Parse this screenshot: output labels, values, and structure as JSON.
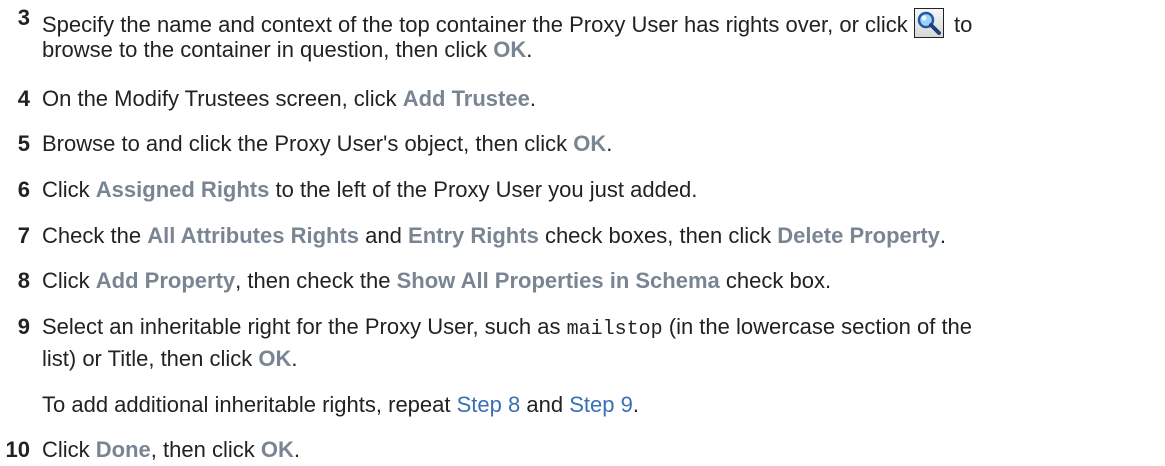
{
  "steps": [
    {
      "number": "3",
      "line1_pre": "Specify the name and context of the top container the Proxy User has rights over, or click",
      "line1_post": "to",
      "line2_pre": "browse to the container in question, then click",
      "line2_ui": "OK",
      "line2_post": "."
    },
    {
      "number": "4",
      "pre": "On the Modify Trustees screen, click",
      "ui": "Add Trustee",
      "post": "."
    },
    {
      "number": "5",
      "pre": "Browse to and click the Proxy User's object, then click",
      "ui": "OK",
      "post": "."
    },
    {
      "number": "6",
      "pre": "Click",
      "ui": "Assigned Rights",
      "post": "to the left of the Proxy User you just added."
    },
    {
      "number": "7",
      "pre": "Check the",
      "ui1": "All Attributes Rights",
      "mid": "and",
      "ui2": "Entry Rights",
      "mid2": "check boxes, then click",
      "ui3": "Delete Property",
      "post": "."
    },
    {
      "number": "8",
      "pre": "Click",
      "ui1": "Add Property",
      "mid": ", then check the",
      "ui2": "Show All Properties in Schema",
      "post": "check box."
    },
    {
      "number": "9",
      "pre": "Select an inheritable right for the Proxy User, such as",
      "code": "mailstop",
      "post": "(in the lowercase section of the",
      "line2_pre": "list) or Title, then click",
      "line2_ui": "OK",
      "line2_post": ".",
      "note_pre": "To add additional inheritable rights, repeat",
      "note_link1": "Step 8",
      "note_mid": "and",
      "note_link2": "Step 9",
      "note_post": "."
    },
    {
      "number": "10",
      "pre": "Click",
      "ui1": "Done",
      "mid": ", then click",
      "ui2": "OK",
      "post": "."
    }
  ],
  "icons": {
    "search_button": "magnifier-search-icon"
  },
  "colors": {
    "text": "#222222",
    "ui_label": "#7a8593",
    "link": "#3a6fb5"
  }
}
